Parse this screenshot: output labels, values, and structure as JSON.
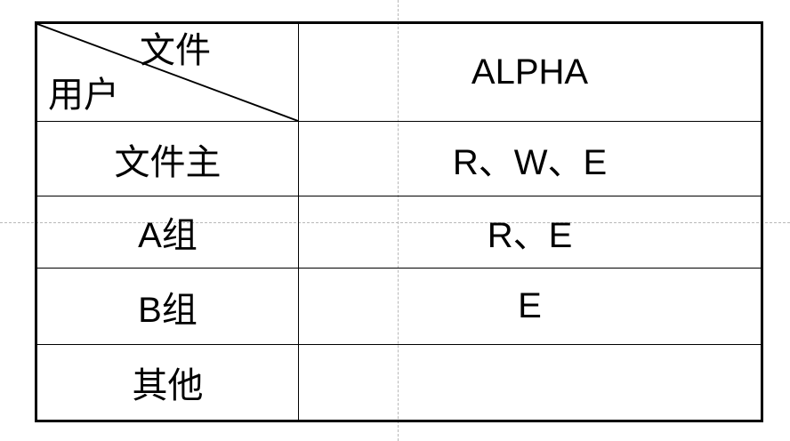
{
  "table": {
    "header": {
      "corner_top": "文件",
      "corner_bottom": "用户",
      "file_column": "ALPHA"
    },
    "rows": [
      {
        "user": "文件主",
        "permissions": "R、W、E"
      },
      {
        "user": "A组",
        "permissions": "R、E"
      },
      {
        "user": "B组",
        "permissions": "E"
      },
      {
        "user": "其他",
        "permissions": ""
      }
    ]
  }
}
